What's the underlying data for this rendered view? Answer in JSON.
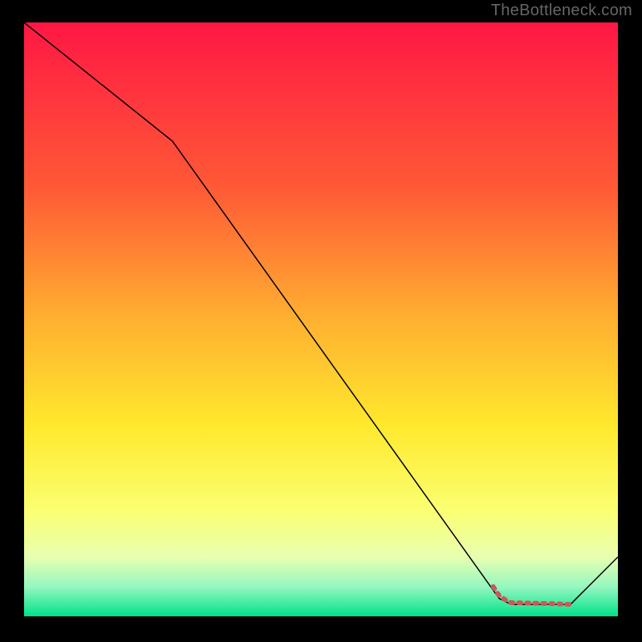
{
  "watermark": "TheBottleneck.com",
  "chart_data": {
    "type": "line",
    "title": "",
    "xlabel": "",
    "ylabel": "",
    "xlim": [
      0,
      100
    ],
    "ylim": [
      0,
      100
    ],
    "grid": false,
    "legend": false,
    "background_gradient": {
      "stops": [
        {
          "offset": 0.0,
          "color": "#ff1744"
        },
        {
          "offset": 0.28,
          "color": "#ff5a36"
        },
        {
          "offset": 0.5,
          "color": "#ffb030"
        },
        {
          "offset": 0.68,
          "color": "#ffe92e"
        },
        {
          "offset": 0.82,
          "color": "#fbff70"
        },
        {
          "offset": 0.9,
          "color": "#e8ffb0"
        },
        {
          "offset": 0.95,
          "color": "#96f7c0"
        },
        {
          "offset": 1.0,
          "color": "#00e28a"
        }
      ]
    },
    "series": [
      {
        "name": "bottleneck-curve",
        "color": "#000000",
        "stroke_width": 1.5,
        "x": [
          0,
          25,
          80,
          82,
          90,
          92,
          100
        ],
        "values": [
          100,
          80,
          3,
          2,
          2,
          2,
          10
        ]
      }
    ],
    "highlight": {
      "name": "optimal-range",
      "color": "#c85a5a",
      "stroke_width": 6,
      "x": [
        79,
        80,
        81,
        82,
        86,
        90,
        92
      ],
      "values": [
        5,
        3.5,
        2.8,
        2.3,
        2.2,
        2.1,
        2.0
      ]
    }
  }
}
